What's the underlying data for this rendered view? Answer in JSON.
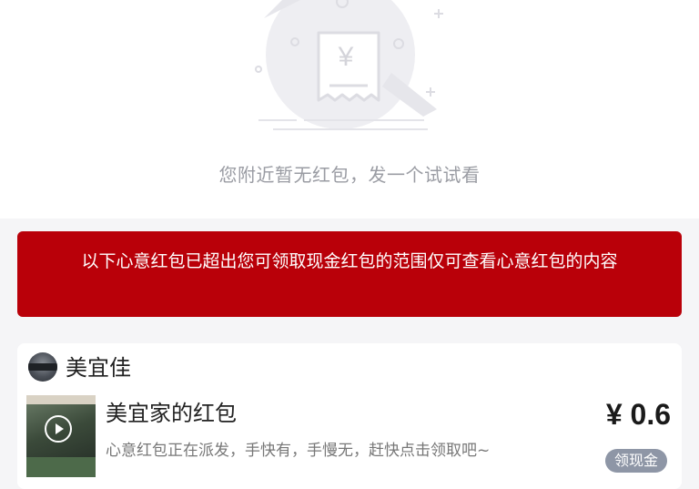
{
  "empty_state": {
    "message": "您附近暂无红包，发一个试试看",
    "illustration_icon": "receipt-yen-icon",
    "currency_glyph": "¥"
  },
  "notice": {
    "text": "以下心意红包已超出您可领取现金红包的范围仅可查看心意红包的内容"
  },
  "card": {
    "shop_name": "美宜佳",
    "packet_title": "美宜家的红包",
    "packet_desc": "心意红包正在派发，手快有，手慢无，赶快点击领取吧~",
    "amount": "¥ 0.6",
    "claim_label": "领现金"
  },
  "colors": {
    "banner_red": "#b90009",
    "claim_button_gray": "#8e96a6"
  }
}
